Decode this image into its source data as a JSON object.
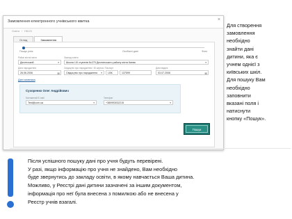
{
  "screenshot": {
    "window_title": "Замовлення електронного учнівського квитка",
    "close_glyph": "×",
    "breadcrumbs": [
      "Освіта",
      "НК123"
    ],
    "tabs": [
      {
        "label": "Огляд",
        "active": false
      },
      {
        "label": "Замовлення",
        "active": true
      }
    ],
    "steps": [
      "Пошук учня",
      "Особисті дані",
      "Фото"
    ],
    "fields": {
      "city_label": "Район міста/ місто",
      "city_value": "Десенський",
      "school_label": "Заклад освіти",
      "school_value": "Школа І-ІІІ ступенів №270 Деснянського району міста Києва",
      "dob_label": "Дата народження",
      "dob_value": "26.06.2006",
      "doc_label": "Свідоцтво про народження / ID картка / Паспорт",
      "doc_type_value": "Свідоцтво про народження",
      "doc_series_value": "І-ВК",
      "doc_number_value": "137599",
      "issue_label": "Дата видачі",
      "issue_value": "03.07.2006"
    },
    "parent_section": "Дані заявника",
    "parent": {
      "name": "Сухоренко Олег Андрійович",
      "email_label": "Контактний E-mail",
      "email_value": "Test@com.ua",
      "phone_label": "Телефон",
      "phone_value": "+380993032215"
    },
    "search_button_label": "Пошук"
  },
  "side_text_lines": [
    "Для створення",
    "замовлення",
    "необхідно",
    "знайти дані",
    "дитини, яка є",
    "учнем однієї з",
    "київських шкіл.",
    "Для пошуку Вам",
    "необхідно",
    "заповнити",
    "вказані поля і",
    "натиснути",
    "кнопку «Пошук»."
  ],
  "bottom_text_lines": [
    "Після успішного пошуку дані про учня будуть перевірені.",
    "У разі, якщо інформацію про учня не знайдено, Вам необхідно",
    "буде звернутись до закладу освіти, в якому навчається Ваша дитина.",
    "Можливо, у Реєстрі дані дитини зазначені за іншим документом,",
    "інформація про неї була внесена з помилкою або не внесена у",
    "Реєстр учнів взагалі."
  ],
  "colors": {
    "accent_blue": "#2a6fd2",
    "search_button": "#2a9085"
  }
}
